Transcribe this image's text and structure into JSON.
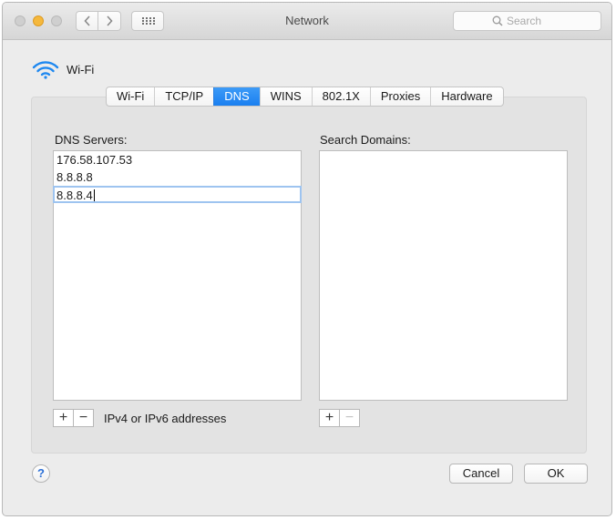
{
  "window": {
    "title": "Network"
  },
  "toolbar": {
    "search_placeholder": "Search",
    "back_icon": "chevron-left-icon",
    "forward_icon": "chevron-right-icon",
    "grid_icon": "grid-icon"
  },
  "interface": {
    "name": "Wi-Fi",
    "icon": "wifi-icon"
  },
  "tabs": [
    {
      "label": "Wi-Fi",
      "active": false
    },
    {
      "label": "TCP/IP",
      "active": false
    },
    {
      "label": "DNS",
      "active": true
    },
    {
      "label": "WINS",
      "active": false
    },
    {
      "label": "802.1X",
      "active": false
    },
    {
      "label": "Proxies",
      "active": false
    },
    {
      "label": "Hardware",
      "active": false
    }
  ],
  "dns": {
    "label": "DNS Servers:",
    "servers": [
      "176.58.107.53",
      "8.8.8.8",
      "8.8.8.4"
    ],
    "editing_index": 2,
    "add_symbol": "+",
    "remove_symbol": "−",
    "hint": "IPv4 or IPv6 addresses"
  },
  "search_domains": {
    "label": "Search Domains:",
    "domains": [],
    "add_symbol": "+",
    "remove_symbol": "−"
  },
  "footer": {
    "help_symbol": "?",
    "cancel_label": "Cancel",
    "ok_label": "OK"
  },
  "colors": {
    "accent": "#1a7ff0",
    "edit_outline": "#9ec4f0",
    "minimize": "#f5b83c",
    "help_blue": "#2b6fd6"
  }
}
